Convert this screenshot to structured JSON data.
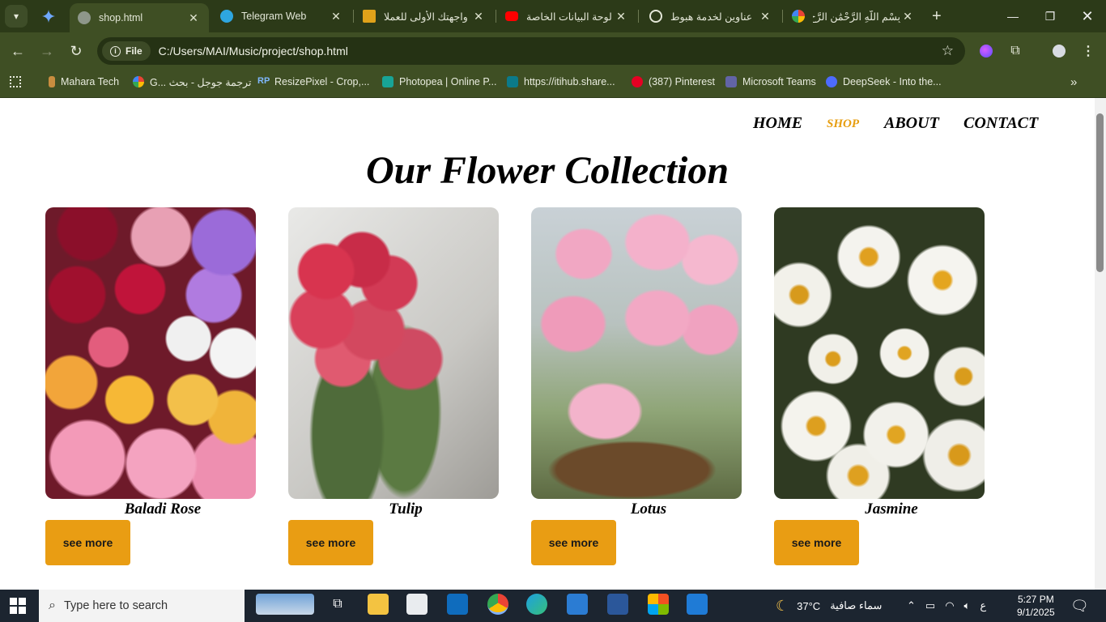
{
  "browser": {
    "tabs": [
      {
        "title": "shop.html",
        "icon": "globe-icon",
        "active": true
      },
      {
        "title": "Telegram Web",
        "icon": "telegram-icon"
      },
      {
        "title": "واجهتك الأولى للعملا",
        "icon": "five-icon"
      },
      {
        "title": "لوحة البيانات الخاصة",
        "icon": "youtube-icon"
      },
      {
        "title": "عناوين لخدمة هبوط",
        "icon": "chatgpt-icon"
      },
      {
        "title": "بِسْمِ اللَّهِ الرَّحْمَٰنِ الرَّحِ",
        "icon": "google-icon"
      }
    ],
    "address": {
      "chip_label": "File",
      "url": "C:/Users/MAI/Music/project/shop.html"
    },
    "bookmarks": [
      {
        "label": "Mahara Tech",
        "icon": "mahara-icon"
      },
      {
        "label": "G... ترجمة جوجل - بحث",
        "icon": "google-icon"
      },
      {
        "label": "ResizePixel - Crop,...",
        "icon": "resizepixel-icon"
      },
      {
        "label": "Photopea | Online P...",
        "icon": "photopea-icon"
      },
      {
        "label": "https://itihub.share...",
        "icon": "sharepoint-icon"
      },
      {
        "label": "(387) Pinterest",
        "icon": "pinterest-icon"
      },
      {
        "label": "Microsoft Teams",
        "icon": "teams-icon"
      },
      {
        "label": "DeepSeek - Into the...",
        "icon": "deepseek-icon"
      }
    ]
  },
  "site": {
    "nav": {
      "home": "HOME",
      "shop": "SHOP",
      "about": "ABOUT",
      "contact": "CONTACT"
    },
    "heading": "Our Flower Collection",
    "products": [
      {
        "name": "Baladi Rose",
        "button": "see more"
      },
      {
        "name": "Tulip",
        "button": "see more"
      },
      {
        "name": "Lotus",
        "button": "see more"
      },
      {
        "name": "Jasmine",
        "button": "see more"
      }
    ],
    "accent_color": "#e99d13"
  },
  "taskbar": {
    "search_placeholder": "Type here to search",
    "weather_temp": "37°C",
    "weather_text": "سماء صافية",
    "lang": "ع",
    "time": "5:27 PM",
    "date": "9/1/2025"
  }
}
